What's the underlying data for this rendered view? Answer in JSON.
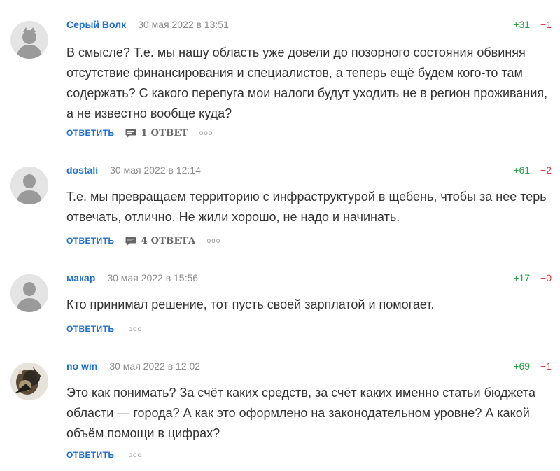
{
  "comments": [
    {
      "author": "Серый Волк",
      "date": "30 мая 2022 в 13:51",
      "plus": "+31",
      "minus": "−1",
      "text": "В смысле? Т.е. мы нашу область уже довели до позорного состояния обвиняя отсутствие финансирования и специалистов, а теперь ещё будем кого-то там содержать? С какого перепуга мои налоги будут уходить не в регион проживания, а не известно вообще куда?",
      "reply_label": "ОТВЕТИТЬ",
      "replies_label": "1 ОТВЕТ",
      "avatar": "wolf-avatar-icon"
    },
    {
      "author": "dostali",
      "date": "30 мая 2022 в 12:14",
      "plus": "+61",
      "minus": "−2",
      "text": "Т.е. мы превращаем территорию с инфраструктурой в щебень, чтобы за нее терь отвечать, отлично. Не жили хорошо, не надо и начинать.",
      "reply_label": "ОТВЕТИТЬ",
      "replies_label": "4 ОТВЕТА",
      "avatar": "default-user-avatar-icon"
    },
    {
      "author": "макар",
      "date": "30 мая 2022 в 15:56",
      "plus": "+17",
      "minus": "−0",
      "text": "Кто принимал решение, тот пусть своей зарплатой и помогает.",
      "reply_label": "ОТВЕТИТЬ",
      "avatar": "default-user-avatar-icon"
    },
    {
      "author": "no win",
      "date": "30 мая 2022 в 12:02",
      "plus": "+69",
      "minus": "−1",
      "text": "Это как понимать? За счёт каких средств, за счёт каких именно статьи бюджета области — города? А как это оформлено на законодательном уровне? А какой объём помощи в цифрах?",
      "reply_label": "ОТВЕТИТЬ",
      "avatar": "photo-avatar-icon"
    }
  ],
  "more_glyph": "ooo",
  "colors": {
    "author": "#1e6fc8",
    "plus": "#26a244",
    "minus": "#e03a3a",
    "date": "#8a8a8a",
    "text": "#333333"
  }
}
